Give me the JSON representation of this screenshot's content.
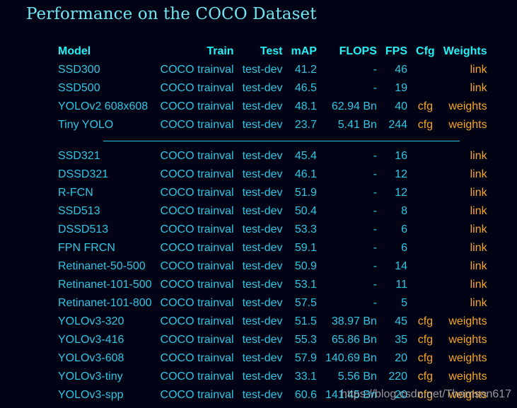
{
  "title": "Performance on the COCO Dataset",
  "columns": [
    "Model",
    "Train",
    "Test",
    "mAP",
    "FLOPS",
    "FPS",
    "Cfg",
    "Weights"
  ],
  "group1": [
    {
      "model": "SSD300",
      "train": "COCO trainval",
      "test": "test-dev",
      "map": "41.2",
      "flops": "-",
      "fps": "46",
      "cfg": "",
      "weights": "link"
    },
    {
      "model": "SSD500",
      "train": "COCO trainval",
      "test": "test-dev",
      "map": "46.5",
      "flops": "-",
      "fps": "19",
      "cfg": "",
      "weights": "link"
    },
    {
      "model": "YOLOv2 608x608",
      "train": "COCO trainval",
      "test": "test-dev",
      "map": "48.1",
      "flops": "62.94 Bn",
      "fps": "40",
      "cfg": "cfg",
      "weights": "weights"
    },
    {
      "model": "Tiny YOLO",
      "train": "COCO trainval",
      "test": "test-dev",
      "map": "23.7",
      "flops": "5.41 Bn",
      "fps": "244",
      "cfg": "cfg",
      "weights": "weights"
    }
  ],
  "group2": [
    {
      "model": "SSD321",
      "train": "COCO trainval",
      "test": "test-dev",
      "map": "45.4",
      "flops": "-",
      "fps": "16",
      "cfg": "",
      "weights": "link"
    },
    {
      "model": "DSSD321",
      "train": "COCO trainval",
      "test": "test-dev",
      "map": "46.1",
      "flops": "-",
      "fps": "12",
      "cfg": "",
      "weights": "link"
    },
    {
      "model": "R-FCN",
      "train": "COCO trainval",
      "test": "test-dev",
      "map": "51.9",
      "flops": "-",
      "fps": "12",
      "cfg": "",
      "weights": "link"
    },
    {
      "model": "SSD513",
      "train": "COCO trainval",
      "test": "test-dev",
      "map": "50.4",
      "flops": "-",
      "fps": "8",
      "cfg": "",
      "weights": "link"
    },
    {
      "model": "DSSD513",
      "train": "COCO trainval",
      "test": "test-dev",
      "map": "53.3",
      "flops": "-",
      "fps": "6",
      "cfg": "",
      "weights": "link"
    },
    {
      "model": "FPN FRCN",
      "train": "COCO trainval",
      "test": "test-dev",
      "map": "59.1",
      "flops": "-",
      "fps": "6",
      "cfg": "",
      "weights": "link"
    },
    {
      "model": "Retinanet-50-500",
      "train": "COCO trainval",
      "test": "test-dev",
      "map": "50.9",
      "flops": "-",
      "fps": "14",
      "cfg": "",
      "weights": "link"
    },
    {
      "model": "Retinanet-101-500",
      "train": "COCO trainval",
      "test": "test-dev",
      "map": "53.1",
      "flops": "-",
      "fps": "11",
      "cfg": "",
      "weights": "link"
    },
    {
      "model": "Retinanet-101-800",
      "train": "COCO trainval",
      "test": "test-dev",
      "map": "57.5",
      "flops": "-",
      "fps": "5",
      "cfg": "",
      "weights": "link"
    },
    {
      "model": "YOLOv3-320",
      "train": "COCO trainval",
      "test": "test-dev",
      "map": "51.5",
      "flops": "38.97 Bn",
      "fps": "45",
      "cfg": "cfg",
      "weights": "weights"
    },
    {
      "model": "YOLOv3-416",
      "train": "COCO trainval",
      "test": "test-dev",
      "map": "55.3",
      "flops": "65.86 Bn",
      "fps": "35",
      "cfg": "cfg",
      "weights": "weights"
    },
    {
      "model": "YOLOv3-608",
      "train": "COCO trainval",
      "test": "test-dev",
      "map": "57.9",
      "flops": "140.69 Bn",
      "fps": "20",
      "cfg": "cfg",
      "weights": "weights"
    },
    {
      "model": "YOLOv3-tiny",
      "train": "COCO trainval",
      "test": "test-dev",
      "map": "33.1",
      "flops": "5.56 Bn",
      "fps": "220",
      "cfg": "cfg",
      "weights": "weights"
    },
    {
      "model": "YOLOv3-spp",
      "train": "COCO trainval",
      "test": "test-dev",
      "map": "60.6",
      "flops": "141.45 Bn",
      "fps": "20",
      "cfg": "cfg",
      "weights": "weights"
    }
  ],
  "watermark": "https://blog.csdn.net/Thomson617",
  "colors": {
    "background": "#030316",
    "title": "#6fe5ef",
    "header": "#24f0f5",
    "text": "#2ec7e2",
    "link": "#f5a623"
  }
}
